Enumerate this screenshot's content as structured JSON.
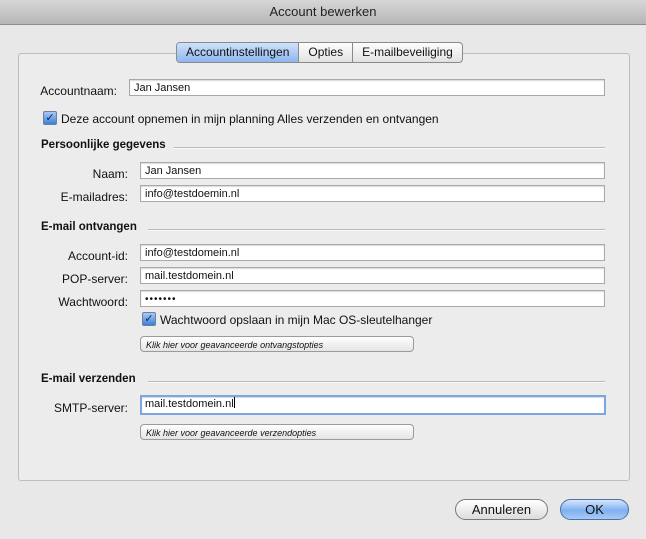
{
  "window": {
    "title": "Account bewerken"
  },
  "tabs": [
    {
      "label": "Accountinstellingen",
      "active": true
    },
    {
      "label": "Opties",
      "active": false
    },
    {
      "label": "E-mailbeveiliging",
      "active": false
    }
  ],
  "account": {
    "name_label": "Accountnaam:",
    "name_value": "Jan Jansen",
    "include_checkbox_label": "Deze account opnemen in mijn planning Alles verzenden en ontvangen",
    "include_checked": true
  },
  "personal": {
    "heading": "Persoonlijke gegevens",
    "name_label": "Naam:",
    "name_value": "Jan Jansen",
    "email_label": "E-mailadres:",
    "email_value": "info@testdoemin.nl"
  },
  "incoming": {
    "heading": "E-mail ontvangen",
    "account_id_label": "Account-id:",
    "account_id_value": "info@testdomein.nl",
    "pop_label": "POP-server:",
    "pop_value": "mail.testdomein.nl",
    "password_label": "Wachtwoord:",
    "password_value": "•••••••",
    "save_password_label": "Wachtwoord opslaan in mijn Mac OS-sleutelhanger",
    "save_password_checked": true,
    "advanced_button": "Klik hier voor geavanceerde ontvangstopties"
  },
  "outgoing": {
    "heading": "E-mail verzenden",
    "smtp_label": "SMTP-server:",
    "smtp_value": "mail.testdomein.nl",
    "advanced_button": "Klik hier voor geavanceerde verzendopties"
  },
  "footer": {
    "cancel": "Annuleren",
    "ok": "OK"
  }
}
